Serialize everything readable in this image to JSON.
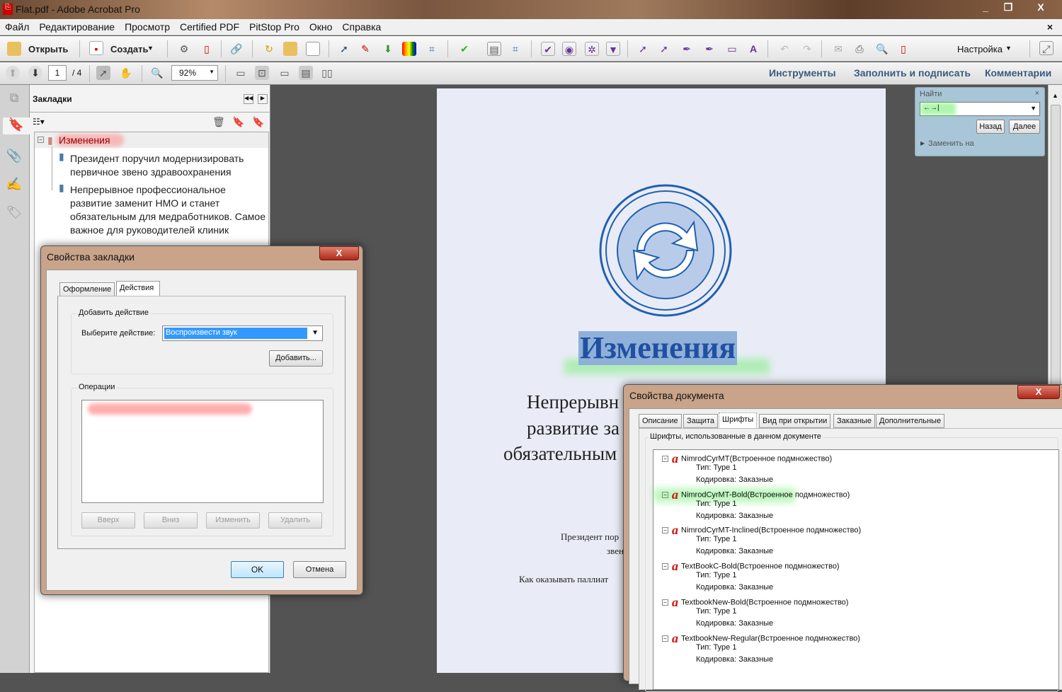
{
  "window": {
    "title": "Flat.pdf - Adobe Acrobat Pro"
  },
  "menu": [
    "Файл",
    "Редактирование",
    "Просмотр",
    "Certified PDF",
    "PitStop Pro",
    "Окно",
    "Справка"
  ],
  "toolbar": {
    "open": "Открыть",
    "create": "Создать",
    "customize": "Настройка"
  },
  "nav": {
    "page": "1",
    "total": "/ 4",
    "zoom": "92%",
    "tools": "Инструменты",
    "fill_sign": "Заполнить и подписать",
    "comments": "Комментарии"
  },
  "bookmarks": {
    "title": "Закладки",
    "items": [
      "Изменения",
      "Президент поручил модернизировать первичное звено здравоохранения",
      "Непрерывное профессиональное развитие заменит НМО и станет обязательным для медработников. Самое важное для руководителей клиник"
    ]
  },
  "page": {
    "heading": "Изменения",
    "lines": [
      "Непрерывн",
      "развитие за",
      "обязательным"
    ],
    "small": [
      "Президент пор",
      "звен",
      "Как оказывать паллиат"
    ]
  },
  "find": {
    "title": "Найти",
    "value": "←→|",
    "back": "Назад",
    "next": "Далее",
    "replace": "Заменить на"
  },
  "bookmark_dialog": {
    "title": "Свойства закладки",
    "tabs": [
      "Оформление",
      "Действия"
    ],
    "add_action": "Добавить действие",
    "select_label": "Выберите действие:",
    "selected": "Воспроизвести звук",
    "add": "Добавить...",
    "operations": "Операции",
    "buttons": [
      "Вверх",
      "Вниз",
      "Изменить",
      "Удалить"
    ],
    "ok": "OK",
    "cancel": "Отмена"
  },
  "doc_dialog": {
    "title": "Свойства документа",
    "tabs": [
      "Описание",
      "Защита",
      "Шрифты",
      "Вид при открытии",
      "Заказные",
      "Дополнительные"
    ],
    "fonts_label": "Шрифты, использованные в данном документе",
    "fonts": [
      {
        "name": "NimrodCyrMT(Встроенное подмножество)",
        "type": "Тип: Type 1",
        "enc": "Кодировка: Заказные"
      },
      {
        "name": "NimrodCyrMT-Bold(Встроенное подмножество)",
        "type": "Тип: Type 1",
        "enc": "Кодировка: Заказные"
      },
      {
        "name": "NimrodCyrMT-Inclined(Встроенное подмножество)",
        "type": "Тип: Type 1",
        "enc": "Кодировка: Заказные"
      },
      {
        "name": "TextBookC-Bold(Встроенное подмножество)",
        "type": "Тип: Type 1",
        "enc": "Кодировка: Заказные"
      },
      {
        "name": "TextbookNew-Bold(Встроенное подмножество)",
        "type": "Тип: Type 1",
        "enc": "Кодировка: Заказные"
      },
      {
        "name": "TextbookNew-Regular(Встроенное подмножество)",
        "type": "Тип: Type 1",
        "enc": "Кодировка: Заказные"
      }
    ]
  }
}
